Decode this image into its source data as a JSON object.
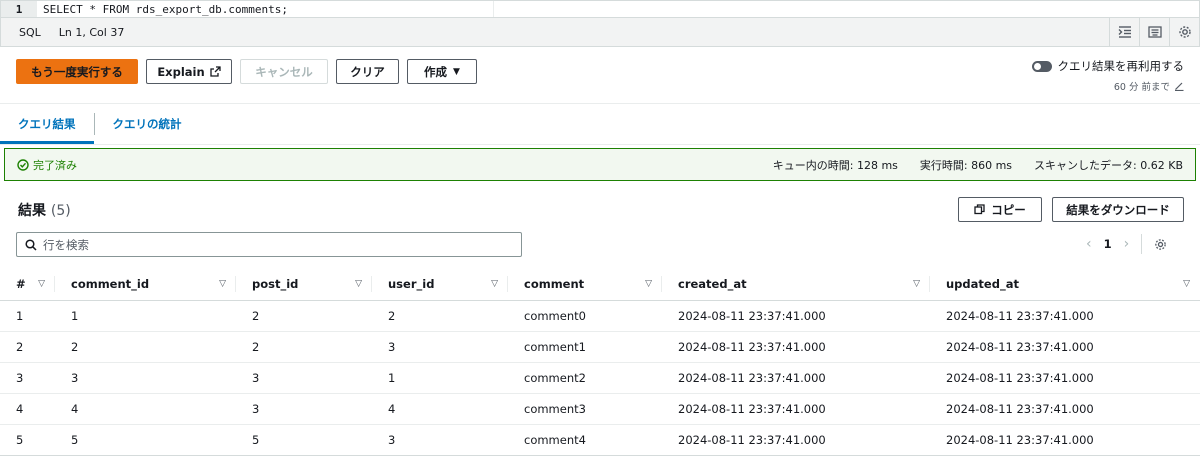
{
  "editor": {
    "line_number": "1",
    "query": "SELECT * FROM rds_export_db.comments;"
  },
  "statusbar": {
    "language": "SQL",
    "position": "Ln 1, Col 37"
  },
  "toolbar": {
    "run_again": "もう一度実行する",
    "explain": "Explain",
    "cancel": "キャンセル",
    "clear": "クリア",
    "create": "作成"
  },
  "reuse": {
    "label": "クエリ結果を再利用する",
    "sub": "60 分 前まで"
  },
  "tabs": {
    "results": "クエリ結果",
    "stats": "クエリの統計"
  },
  "flash": {
    "status": "完了済み",
    "queue_time": "キュー内の時間: 128 ms",
    "run_time": "実行時間: 860 ms",
    "scanned": "スキャンしたデータ: 0.62 KB"
  },
  "results": {
    "title": "結果",
    "count": "(5)",
    "copy": "コピー",
    "download": "結果をダウンロード",
    "search_placeholder": "行を検索",
    "page": "1"
  },
  "table": {
    "headers": [
      "#",
      "comment_id",
      "post_id",
      "user_id",
      "comment",
      "created_at",
      "updated_at"
    ],
    "rows": [
      [
        "1",
        "1",
        "2",
        "2",
        "comment0",
        "2024-08-11 23:37:41.000",
        "2024-08-11 23:37:41.000"
      ],
      [
        "2",
        "2",
        "2",
        "3",
        "comment1",
        "2024-08-11 23:37:41.000",
        "2024-08-11 23:37:41.000"
      ],
      [
        "3",
        "3",
        "3",
        "1",
        "comment2",
        "2024-08-11 23:37:41.000",
        "2024-08-11 23:37:41.000"
      ],
      [
        "4",
        "4",
        "3",
        "4",
        "comment3",
        "2024-08-11 23:37:41.000",
        "2024-08-11 23:37:41.000"
      ],
      [
        "5",
        "5",
        "5",
        "3",
        "comment4",
        "2024-08-11 23:37:41.000",
        "2024-08-11 23:37:41.000"
      ]
    ]
  },
  "colors": {
    "primary": "#ec7211",
    "link": "#0073bb",
    "success": "#1d8102"
  }
}
